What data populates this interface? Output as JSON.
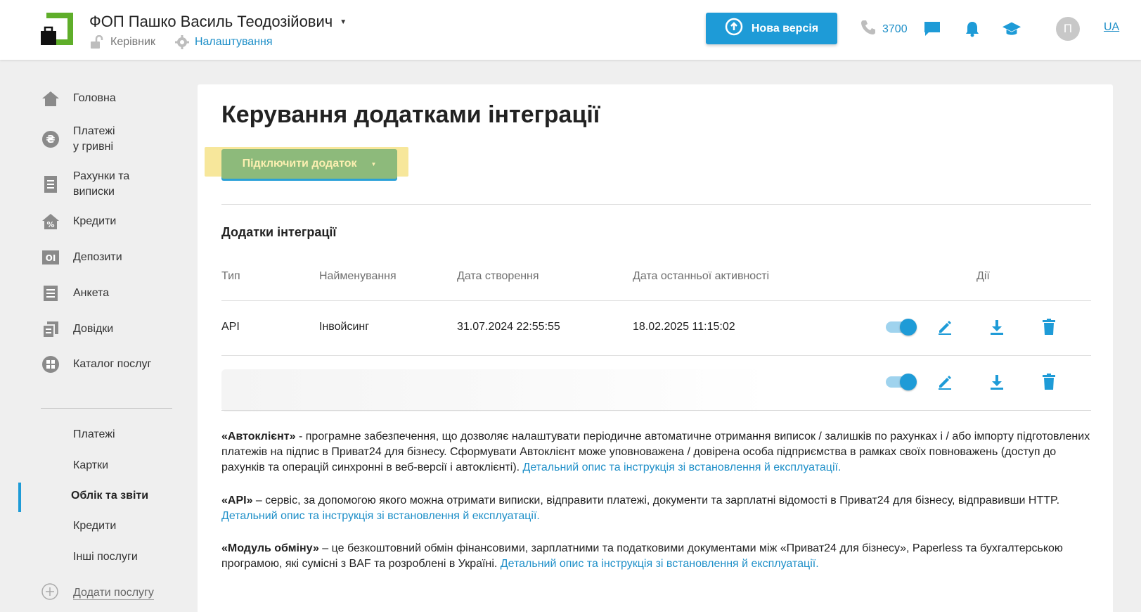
{
  "header": {
    "org_name": "ФОП Пашко Василь Теодозійович",
    "role": "Керівник",
    "settings_label": "Налаштування",
    "new_version_label": "Нова версія",
    "phone_label": "3700",
    "avatar_letter": "П",
    "lang": "UA"
  },
  "sidebar": {
    "items": [
      {
        "label": "Головна",
        "icon": "home-icon"
      },
      {
        "label": "Платежі\nу гривні",
        "icon": "hryvnia-icon"
      },
      {
        "label": "Рахунки та\nвиписки",
        "icon": "document-icon"
      },
      {
        "label": "Кредити",
        "icon": "house-percent-icon"
      },
      {
        "label": "Депозити",
        "icon": "deposit-icon"
      },
      {
        "label": "Анкета",
        "icon": "form-icon"
      },
      {
        "label": "Довідки",
        "icon": "certificates-icon"
      },
      {
        "label": "Каталог послуг",
        "icon": "catalog-icon"
      }
    ],
    "sub_items": [
      "Платежі",
      "Картки",
      "Облік та звіти",
      "Кредити",
      "Інші послуги"
    ],
    "active_sub": "Облік та звіти",
    "add_service": "Додати послугу"
  },
  "main": {
    "title": "Керування додатками інтеграції",
    "connect_button": "Підключити додаток",
    "section_title": "Додатки інтеграції",
    "columns": [
      "Тип",
      "Найменування",
      "Дата створення",
      "Дата останньої активності",
      "Дії"
    ],
    "rows": [
      {
        "type": "API",
        "name": "Інвойсинг",
        "created": "31.07.2024 22:55:55",
        "last_active": "18.02.2025 11:15:02",
        "enabled": true
      },
      {
        "type": "",
        "name": "",
        "created": "",
        "last_active": "",
        "enabled": true
      }
    ],
    "descriptions": [
      {
        "term": "«Автоклієнт»",
        "text": " - програмне забезпечення, що дозволяє налаштувати періодичне автоматичне отримання виписок / залишків по рахунках і / або імпорту підготовлених платежів на підпис в Приват24 для бізнесу. Сформувати Автоклієнт може уповноважена / довірена особа підприємства в рамках своїх повноважень (доступ до рахунків та операцій синхронні в веб-версії і автоклієнті). ",
        "link": "Детальний опис та інструкція зі встановлення й експлуатації."
      },
      {
        "term": "«API»",
        "text": " – сервіс, за допомогою якого можна отримати виписки, відправити платежі, документи та зарплатні відомості в Приват24 для бізнесу, відправивши HTTP. ",
        "link": "Детальний опис та інструкція зі встановлення й експлуатації."
      },
      {
        "term": "«Модуль обміну»",
        "text": " – це безкоштовний обмін фінансовими, зарплатними та податковими документами між «Приват24 для бізнесу», Paperless та бухгалтерською програмою, які сумісні з BAF та розроблені в Україні. ",
        "link": "Детальний опис та інструкція зі встановлення й експлуатації."
      }
    ]
  },
  "colors": {
    "accent": "#1e9bd7",
    "link": "#1e8fc8",
    "brand_green": "#5fae2a",
    "connect_btn": "#8dba7b"
  }
}
